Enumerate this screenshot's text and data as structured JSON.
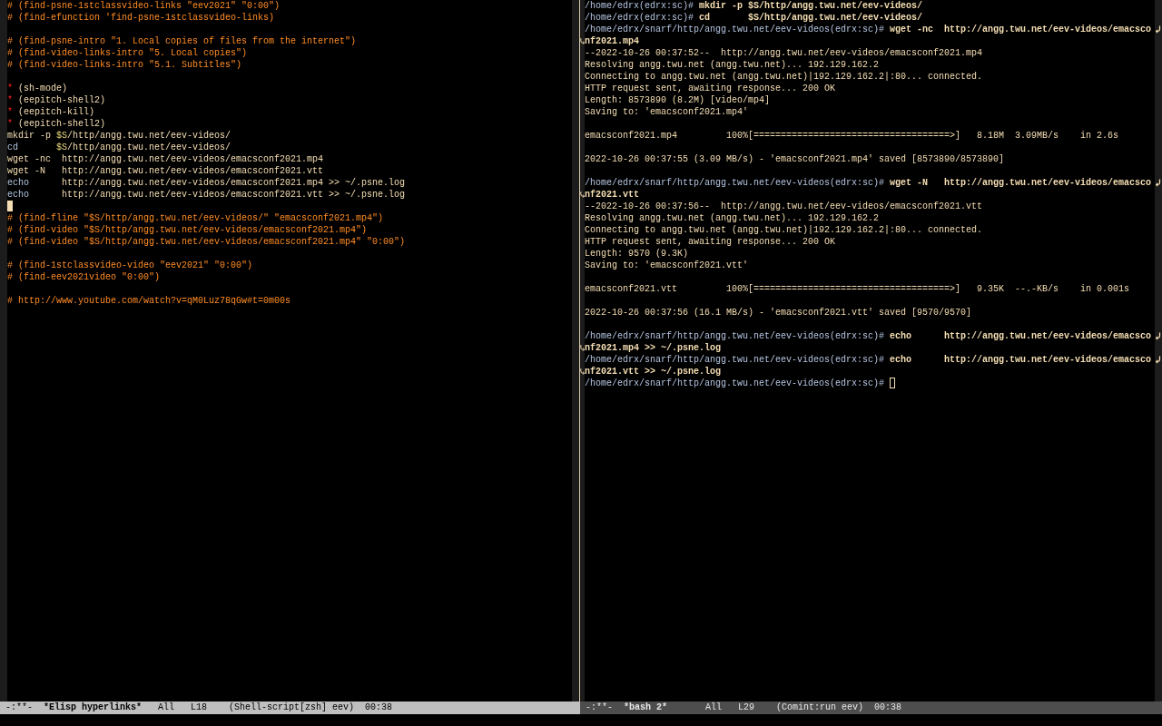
{
  "left_window": {
    "active": true,
    "lines": [
      {
        "kind": "comment",
        "text": "# (find-psne-1stclassvideo-links \"eev2021\" \"0:00\")"
      },
      {
        "kind": "comment",
        "text": "# (find-efunction 'find-psne-1stclassvideo-links)"
      },
      {
        "kind": "blank"
      },
      {
        "kind": "comment",
        "text": "# (find-psne-intro \"1. Local copies of files from the internet\")"
      },
      {
        "kind": "comment",
        "text": "# (find-video-links-intro \"5. Local copies\")"
      },
      {
        "kind": "comment",
        "text": "# (find-video-links-intro \"5.1. Subtitles\")"
      },
      {
        "kind": "blank"
      },
      {
        "kind": "heading",
        "star": "*",
        "text": "(sh-mode)"
      },
      {
        "kind": "heading",
        "star": "*",
        "text": "(eepitch-shell2)"
      },
      {
        "kind": "heading",
        "star": "*",
        "text": "(eepitch-kill)"
      },
      {
        "kind": "heading",
        "star": "*",
        "text": "(eepitch-shell2)"
      },
      {
        "kind": "code",
        "segments": [
          {
            "kind": "plain",
            "text": "mkdir -p "
          },
          {
            "kind": "variable",
            "text": "$S"
          },
          {
            "kind": "plain",
            "text": "/http/angg.twu.net/eev-videos/"
          }
        ]
      },
      {
        "kind": "code",
        "segments": [
          {
            "kind": "builtin",
            "text": "cd       "
          },
          {
            "kind": "variable",
            "text": "$S"
          },
          {
            "kind": "plain",
            "text": "/http/angg.twu.net/eev-videos/"
          }
        ]
      },
      {
        "kind": "code",
        "segments": [
          {
            "kind": "plain",
            "text": "wget -nc  http://angg.twu.net/eev-videos/emacsconf2021.mp4"
          }
        ]
      },
      {
        "kind": "code",
        "segments": [
          {
            "kind": "plain",
            "text": "wget -N   http://angg.twu.net/eev-videos/emacsconf2021.vtt"
          }
        ]
      },
      {
        "kind": "code",
        "segments": [
          {
            "kind": "builtin",
            "text": "echo      "
          },
          {
            "kind": "plain",
            "text": "http://angg.twu.net/eev-videos/emacsconf2021.mp4 >> ~/.psne.log"
          }
        ]
      },
      {
        "kind": "code",
        "segments": [
          {
            "kind": "builtin",
            "text": "echo      "
          },
          {
            "kind": "plain",
            "text": "http://angg.twu.net/eev-videos/emacsconf2021.vtt >> ~/.psne.log"
          }
        ]
      },
      {
        "kind": "cursor"
      },
      {
        "kind": "comment",
        "text": "# (find-fline \"$S/http/angg.twu.net/eev-videos/\" \"emacsconf2021.mp4\")"
      },
      {
        "kind": "comment",
        "text": "# (find-video \"$S/http/angg.twu.net/eev-videos/emacsconf2021.mp4\")"
      },
      {
        "kind": "comment",
        "text": "# (find-video \"$S/http/angg.twu.net/eev-videos/emacsconf2021.mp4\" \"0:00\")"
      },
      {
        "kind": "blank"
      },
      {
        "kind": "comment",
        "text": "# (find-1stclassvideo-video \"eev2021\" \"0:00\")"
      },
      {
        "kind": "comment",
        "text": "# (find-eev2021video \"0:00\")"
      },
      {
        "kind": "blank"
      },
      {
        "kind": "comment",
        "text": "# http://www.youtube.com/watch?v=qM0Luz78qGw#t=0m00s"
      }
    ],
    "mode_line": {
      "status": "-:**-",
      "buffer": "*Elisp hyperlinks*",
      "position": "All",
      "line": "L18",
      "modes": "(Shell-script[zsh] eev)",
      "time": "00:38"
    }
  },
  "right_window": {
    "active": false,
    "lines": [
      {
        "kind": "prompt",
        "prompt": "/home/edrx(edrx:sc)#",
        "command": "mkdir -p $S/http/angg.twu.net/eev-videos/",
        "cursor": false
      },
      {
        "kind": "prompt",
        "prompt": "/home/edrx(edrx:sc)#",
        "command": "cd       $S/http/angg.twu.net/eev-videos/",
        "cursor": false
      },
      {
        "kind": "prompt",
        "prompt": "/home/edrx/snarf/http/angg.twu.net/eev-videos(edrx:sc)#",
        "command": "wget -nc  http://angg.twu.net/eev-videos/emacsco",
        "wrapped": "nf2021.mp4",
        "cursor": false
      },
      {
        "kind": "output",
        "text": "--2022-10-26 00:37:52--  http://angg.twu.net/eev-videos/emacsconf2021.mp4"
      },
      {
        "kind": "output",
        "text": "Resolving angg.twu.net (angg.twu.net)... 192.129.162.2"
      },
      {
        "kind": "output",
        "text": "Connecting to angg.twu.net (angg.twu.net)|192.129.162.2|:80... connected."
      },
      {
        "kind": "output",
        "text": "HTTP request sent, awaiting response... 200 OK"
      },
      {
        "kind": "output",
        "text": "Length: 8573890 (8.2M) [video/mp4]"
      },
      {
        "kind": "output",
        "text": "Saving to: 'emacsconf2021.mp4'"
      },
      {
        "kind": "blank"
      },
      {
        "kind": "output",
        "text": "emacsconf2021.mp4         100%[====================================>]   8.18M  3.09MB/s    in 2.6s"
      },
      {
        "kind": "blank"
      },
      {
        "kind": "output",
        "text": "2022-10-26 00:37:55 (3.09 MB/s) - 'emacsconf2021.mp4' saved [8573890/8573890]"
      },
      {
        "kind": "blank"
      },
      {
        "kind": "prompt",
        "prompt": "/home/edrx/snarf/http/angg.twu.net/eev-videos(edrx:sc)#",
        "command": "wget -N   http://angg.twu.net/eev-videos/emacsco",
        "wrapped": "nf2021.vtt",
        "cursor": false
      },
      {
        "kind": "output",
        "text": "--2022-10-26 00:37:56--  http://angg.twu.net/eev-videos/emacsconf2021.vtt"
      },
      {
        "kind": "output",
        "text": "Resolving angg.twu.net (angg.twu.net)... 192.129.162.2"
      },
      {
        "kind": "output",
        "text": "Connecting to angg.twu.net (angg.twu.net)|192.129.162.2|:80... connected."
      },
      {
        "kind": "output",
        "text": "HTTP request sent, awaiting response... 200 OK"
      },
      {
        "kind": "output",
        "text": "Length: 9570 (9.3K)"
      },
      {
        "kind": "output",
        "text": "Saving to: 'emacsconf2021.vtt'"
      },
      {
        "kind": "blank"
      },
      {
        "kind": "output",
        "text": "emacsconf2021.vtt         100%[====================================>]   9.35K  --.-KB/s    in 0.001s"
      },
      {
        "kind": "blank"
      },
      {
        "kind": "output",
        "text": "2022-10-26 00:37:56 (16.1 MB/s) - 'emacsconf2021.vtt' saved [9570/9570]"
      },
      {
        "kind": "blank"
      },
      {
        "kind": "prompt",
        "prompt": "/home/edrx/snarf/http/angg.twu.net/eev-videos(edrx:sc)#",
        "command": "echo      http://angg.twu.net/eev-videos/emacsco",
        "wrapped": "nf2021.mp4 >> ~/.psne.log",
        "cursor": false
      },
      {
        "kind": "prompt",
        "prompt": "/home/edrx/snarf/http/angg.twu.net/eev-videos(edrx:sc)#",
        "command": "echo      http://angg.twu.net/eev-videos/emacsco",
        "wrapped": "nf2021.vtt >> ~/.psne.log",
        "cursor": false
      },
      {
        "kind": "prompt",
        "prompt": "/home/edrx/snarf/http/angg.twu.net/eev-videos(edrx:sc)#",
        "cursor": true
      }
    ],
    "mode_line": {
      "status": "-:**-",
      "buffer": "*bash 2*",
      "position": "All",
      "line": "L29",
      "modes": "(Comint:run eev)",
      "time": "00:38"
    }
  }
}
